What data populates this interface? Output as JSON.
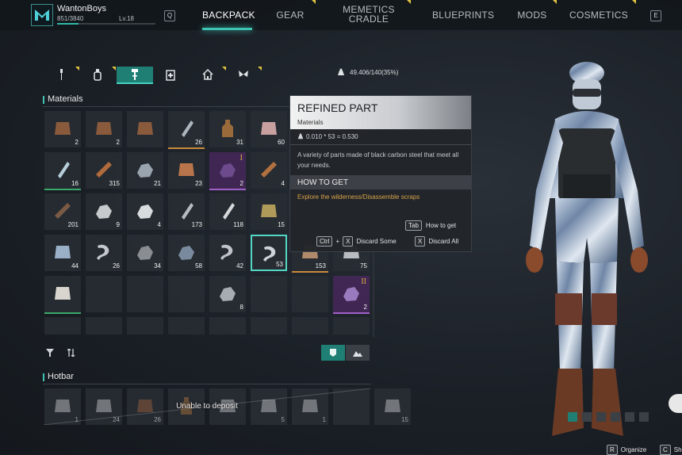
{
  "player": {
    "name": "WantonBoys",
    "xp": "851/3840",
    "level": "Lv.18",
    "xp_fraction": 0.22
  },
  "nav": {
    "left_key": "Q",
    "right_key": "E",
    "tabs": [
      "BACKPACK",
      "GEAR",
      "MEMETICS",
      "CRADLE",
      "BLUEPRINTS",
      "MODS",
      "COSMETICS"
    ],
    "active": "BACKPACK"
  },
  "subtabs": [
    {
      "icon": "wrench-icon"
    },
    {
      "icon": "bottle-icon"
    },
    {
      "icon": "part-icon"
    },
    {
      "icon": "medkit-icon"
    },
    {
      "icon": "house-icon"
    },
    {
      "icon": "butterfly-icon"
    }
  ],
  "weight": "49.406/140(35%)",
  "materials": {
    "title": "Materials",
    "items": [
      {
        "count": "2",
        "rarity": "",
        "icon": "bag-icon"
      },
      {
        "count": "2",
        "rarity": "",
        "icon": "bag-icon"
      },
      {
        "count": "",
        "rarity": "",
        "icon": "bag-icon"
      },
      {
        "count": "26",
        "rarity": "gold",
        "icon": "flashlight-icon"
      },
      {
        "count": "31",
        "rarity": "",
        "icon": "bottle-icon"
      },
      {
        "count": "60",
        "rarity": "",
        "icon": "cake-icon"
      },
      {
        "count": "16",
        "rarity": "green",
        "icon": "tube-icon"
      },
      {
        "count": "315",
        "rarity": "",
        "icon": "log-icon"
      },
      {
        "count": "21",
        "rarity": "",
        "icon": "ore-icon"
      },
      {
        "count": "23",
        "rarity": "",
        "icon": "copper-icon"
      },
      {
        "count": "2",
        "rarity": "purple",
        "icon": "crystal-icon",
        "roman": "I"
      },
      {
        "count": "4",
        "rarity": "",
        "icon": "plank-icon"
      },
      {
        "count": "201",
        "rarity": "",
        "icon": "branch-icon"
      },
      {
        "count": "9",
        "rarity": "",
        "icon": "rocks-icon"
      },
      {
        "count": "4",
        "rarity": "",
        "icon": "stones-icon"
      },
      {
        "count": "173",
        "rarity": "",
        "icon": "can-icon"
      },
      {
        "count": "118",
        "rarity": "",
        "icon": "pipe-icon"
      },
      {
        "count": "15",
        "rarity": "",
        "icon": "fiber-icon"
      },
      {
        "count": "44",
        "rarity": "",
        "icon": "plate-icon"
      },
      {
        "count": "26",
        "rarity": "",
        "icon": "wrench-icon"
      },
      {
        "count": "34",
        "rarity": "",
        "icon": "scrap-icon"
      },
      {
        "count": "58",
        "rarity": "",
        "icon": "gravel-icon"
      },
      {
        "count": "42",
        "rarity": "",
        "icon": "bolt-icon"
      },
      {
        "count": "53",
        "rarity": "",
        "icon": "refined-part-icon"
      },
      {
        "count": "153",
        "rarity": "gold",
        "icon": "parts-icon"
      },
      {
        "count": "75",
        "rarity": "",
        "icon": "metal-icon"
      },
      {
        "count": "",
        "rarity": "green",
        "icon": "cloth-icon"
      },
      {
        "count": "",
        "rarity": "",
        "icon": ""
      },
      {
        "count": "",
        "rarity": "",
        "icon": ""
      },
      {
        "count": "",
        "rarity": "",
        "icon": ""
      },
      {
        "count": "8",
        "rarity": "",
        "icon": "shard-icon"
      },
      {
        "count": "",
        "rarity": "",
        "icon": ""
      },
      {
        "count": "",
        "rarity": "",
        "icon": ""
      },
      {
        "count": "2",
        "rarity": "purple",
        "icon": "gem-icon",
        "roman": "II"
      }
    ]
  },
  "tooltip": {
    "title": "REFINED PART",
    "category": "Materials",
    "weight": "0.010 * 53 = 0.530",
    "description": "A variety of parts made of black carbon steel that meet all your needs.",
    "how_title": "HOW TO GET",
    "how_text": "Explore the wilderness/Disassemble scraps",
    "tab_key": "Tab",
    "tab_label": "How to get",
    "ctrl_key": "Ctrl",
    "plus": "+",
    "x_key": "X",
    "discard_some": "Discard Some",
    "discard_all": "Discard All"
  },
  "hotbar": {
    "title": "Hotbar",
    "unable": "Unable to deposit",
    "slots": [
      {
        "count": "1",
        "icon": "grenade-icon"
      },
      {
        "count": "24",
        "icon": "mug-icon"
      },
      {
        "count": "26",
        "icon": "bag-icon"
      },
      {
        "count": "",
        "icon": "bottle-icon"
      },
      {
        "count": "",
        "icon": "hammer-icon"
      },
      {
        "count": "5",
        "icon": "meat-icon"
      },
      {
        "count": "1",
        "icon": "syringe-icon"
      },
      {
        "count": "",
        "icon": "empty"
      },
      {
        "count": "15",
        "icon": "rod-icon"
      }
    ]
  },
  "bottom": {
    "organize_key": "R",
    "organize": "Organize",
    "c_key": "C",
    "c_label": "Sh"
  },
  "colors": {
    "accent": "#3fc4b4",
    "gold": "#c88a3a",
    "purple": "#a060c8",
    "orange_text": "#d7a24a"
  }
}
